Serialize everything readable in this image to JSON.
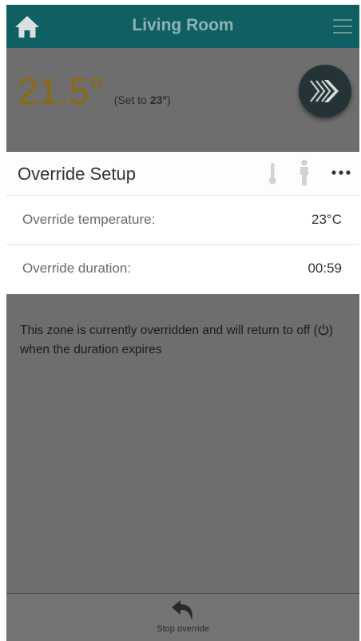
{
  "header": {
    "title": "Living Room",
    "home_icon": "home-icon",
    "menu_icon": "hamburger-menu-icon"
  },
  "zone": {
    "current_temp": "21.5°",
    "set_prefix": "(Set to ",
    "set_value": "23°",
    "set_suffix": ")",
    "fab_icon": "chevrons-right-icon"
  },
  "panel": {
    "title": "Override Setup",
    "icons": [
      "thermometer-icon",
      "person-icon",
      "more-icon"
    ],
    "rows": [
      {
        "label": "Override temperature:",
        "value": "23°C"
      },
      {
        "label": "Override duration:",
        "value": "00:59"
      }
    ]
  },
  "info": {
    "text_before": "This zone is currently overridden and will return to off (",
    "power_icon": "power-icon",
    "text_after": ") when the duration expires"
  },
  "footer": {
    "stop_label": "Stop override",
    "stop_icon": "undo-arrow-icon"
  },
  "colors": {
    "header_bg": "#0f5f63",
    "overlay_bg": "#6e6e6e",
    "temp_color": "#8a6a12",
    "fab_bg": "#243436"
  }
}
